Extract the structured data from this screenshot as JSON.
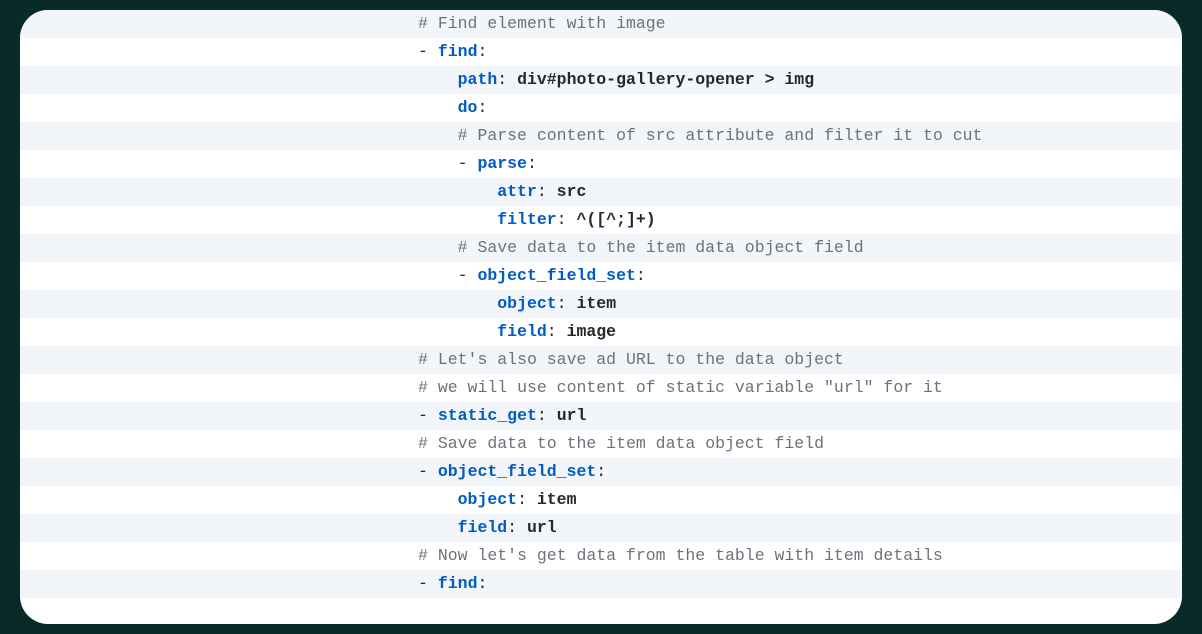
{
  "lines": [
    {
      "indent": 20,
      "stripe": true,
      "tokens": [
        {
          "t": "comment",
          "v": "# Find element with image"
        }
      ]
    },
    {
      "indent": 20,
      "stripe": false,
      "tokens": [
        {
          "t": "punct",
          "v": "- "
        },
        {
          "t": "key",
          "v": "find"
        },
        {
          "t": "punct",
          "v": ":"
        }
      ]
    },
    {
      "indent": 24,
      "stripe": true,
      "tokens": [
        {
          "t": "key",
          "v": "path"
        },
        {
          "t": "punct",
          "v": ": "
        },
        {
          "t": "value",
          "v": "div#photo-gallery-opener > img"
        }
      ]
    },
    {
      "indent": 24,
      "stripe": false,
      "tokens": [
        {
          "t": "key",
          "v": "do"
        },
        {
          "t": "punct",
          "v": ":"
        }
      ]
    },
    {
      "indent": 24,
      "stripe": true,
      "tokens": [
        {
          "t": "comment",
          "v": "# Parse content of src attribute and filter it to cut"
        }
      ]
    },
    {
      "indent": 24,
      "stripe": false,
      "tokens": [
        {
          "t": "punct",
          "v": "- "
        },
        {
          "t": "key",
          "v": "parse"
        },
        {
          "t": "punct",
          "v": ":"
        }
      ]
    },
    {
      "indent": 28,
      "stripe": true,
      "tokens": [
        {
          "t": "key",
          "v": "attr"
        },
        {
          "t": "punct",
          "v": ": "
        },
        {
          "t": "value",
          "v": "src"
        }
      ]
    },
    {
      "indent": 28,
      "stripe": false,
      "tokens": [
        {
          "t": "key",
          "v": "filter"
        },
        {
          "t": "punct",
          "v": ": "
        },
        {
          "t": "value",
          "v": "^([^;]+)"
        }
      ]
    },
    {
      "indent": 24,
      "stripe": true,
      "tokens": [
        {
          "t": "comment",
          "v": "# Save data to the item data object field"
        }
      ]
    },
    {
      "indent": 24,
      "stripe": false,
      "tokens": [
        {
          "t": "punct",
          "v": "- "
        },
        {
          "t": "key",
          "v": "object_field_set"
        },
        {
          "t": "punct",
          "v": ":"
        }
      ]
    },
    {
      "indent": 28,
      "stripe": true,
      "tokens": [
        {
          "t": "key",
          "v": "object"
        },
        {
          "t": "punct",
          "v": ": "
        },
        {
          "t": "value",
          "v": "item"
        }
      ]
    },
    {
      "indent": 28,
      "stripe": false,
      "tokens": [
        {
          "t": "key",
          "v": "field"
        },
        {
          "t": "punct",
          "v": ": "
        },
        {
          "t": "value",
          "v": "image"
        }
      ]
    },
    {
      "indent": 20,
      "stripe": true,
      "tokens": [
        {
          "t": "comment",
          "v": "# Let's also save ad URL to the data object"
        }
      ]
    },
    {
      "indent": 20,
      "stripe": false,
      "tokens": [
        {
          "t": "comment",
          "v": "# we will use content of static variable \"url\" for it"
        }
      ]
    },
    {
      "indent": 20,
      "stripe": true,
      "tokens": [
        {
          "t": "punct",
          "v": "- "
        },
        {
          "t": "key",
          "v": "static_get"
        },
        {
          "t": "punct",
          "v": ": "
        },
        {
          "t": "value",
          "v": "url"
        }
      ]
    },
    {
      "indent": 20,
      "stripe": false,
      "tokens": [
        {
          "t": "comment",
          "v": "# Save data to the item data object field"
        }
      ]
    },
    {
      "indent": 20,
      "stripe": true,
      "tokens": [
        {
          "t": "punct",
          "v": "- "
        },
        {
          "t": "key",
          "v": "object_field_set"
        },
        {
          "t": "punct",
          "v": ":"
        }
      ]
    },
    {
      "indent": 24,
      "stripe": false,
      "tokens": [
        {
          "t": "key",
          "v": "object"
        },
        {
          "t": "punct",
          "v": ": "
        },
        {
          "t": "value",
          "v": "item"
        }
      ]
    },
    {
      "indent": 24,
      "stripe": true,
      "tokens": [
        {
          "t": "key",
          "v": "field"
        },
        {
          "t": "punct",
          "v": ": "
        },
        {
          "t": "value",
          "v": "url"
        }
      ]
    },
    {
      "indent": 20,
      "stripe": false,
      "tokens": [
        {
          "t": "comment",
          "v": "# Now let's get data from the table with item details"
        }
      ]
    },
    {
      "indent": 20,
      "stripe": true,
      "tokens": [
        {
          "t": "punct",
          "v": "- "
        },
        {
          "t": "key",
          "v": "find"
        },
        {
          "t": "punct",
          "v": ":"
        }
      ]
    }
  ]
}
